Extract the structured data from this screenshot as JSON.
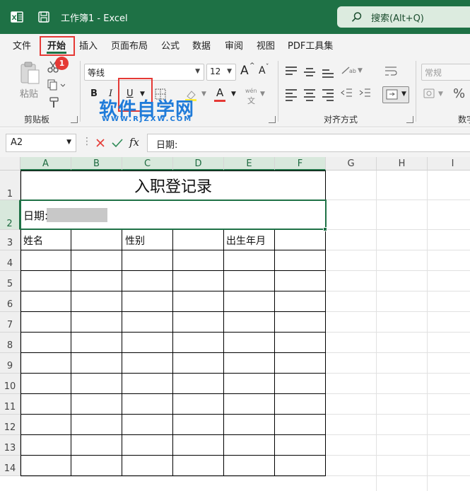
{
  "titlebar": {
    "title": "工作簿1  -  Excel",
    "search_label": "搜索(Alt+Q)",
    "app_icon": "excel-logo-icon",
    "save_icon": "save-icon"
  },
  "tabs": [
    {
      "label": "文件"
    },
    {
      "label": "开始"
    },
    {
      "label": "插入"
    },
    {
      "label": "页面布局"
    },
    {
      "label": "公式"
    },
    {
      "label": "数据"
    },
    {
      "label": "审阅"
    },
    {
      "label": "视图"
    },
    {
      "label": "PDF工具集"
    }
  ],
  "annotation": {
    "badge": "1"
  },
  "ribbon": {
    "paste_label": "粘贴",
    "clipboard_group": "剪贴板",
    "font_name": "等线",
    "font_size": "12",
    "grow_font": "A",
    "shrink_font": "A",
    "bold": "B",
    "italic": "I",
    "underline": "U",
    "font_color_letter": "A",
    "phonetic_label": "wén",
    "alignment_group": "对齐方式",
    "number_format": "常规",
    "number_group": "数字",
    "percent": "%"
  },
  "watermark": {
    "main": "软件自学网",
    "sub": "WWW.RJZXW.COM"
  },
  "formulabar": {
    "name_box": "A2",
    "fx": "fx",
    "content": "日期:"
  },
  "sheet": {
    "columns": [
      "A",
      "B",
      "C",
      "D",
      "E",
      "F",
      "G",
      "H",
      "I"
    ],
    "rows": [
      "1",
      "2",
      "3",
      "4",
      "5",
      "6",
      "7",
      "8",
      "9",
      "10",
      "11",
      "12",
      "13",
      "14"
    ],
    "title": "入职登记录",
    "date_label": "日期:",
    "headers": {
      "name": "姓名",
      "gender": "性别",
      "birth": "出生年月"
    }
  },
  "colors": {
    "excel_green": "#1e7145",
    "annotation_red": "#e53935",
    "watermark_blue": "#1f7bd9"
  }
}
